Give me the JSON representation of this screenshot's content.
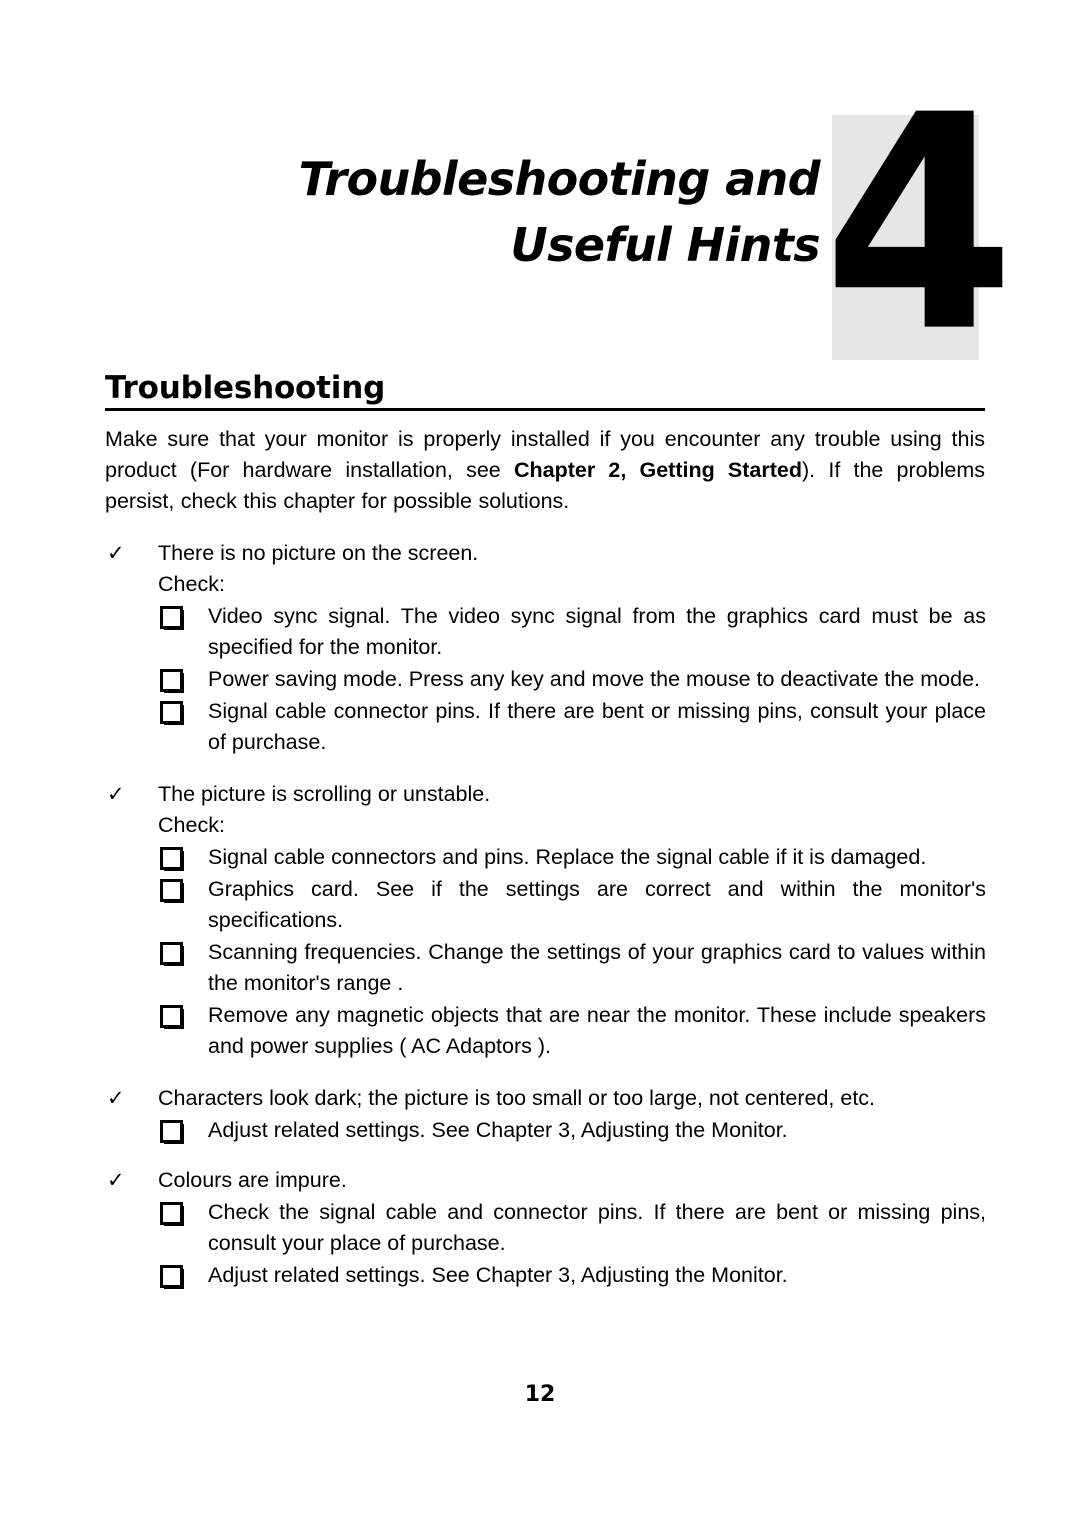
{
  "chapter": {
    "number": "4",
    "title_line1": "Troubleshooting and",
    "title_line2": "Useful Hints",
    "badge_color": "#e6e6e6"
  },
  "section": {
    "heading": "Troubleshooting",
    "intro_part1": "Make sure that your monitor is properly installed if you encounter any trouble using this product (For hardware installation, see ",
    "intro_bold": "Chapter 2, Getting Started",
    "intro_part2": ").  If the problems persist, check this chapter for possible solutions."
  },
  "groups": [
    {
      "tick_icon": "✓",
      "symptom": "There is no picture on the screen.",
      "check_label": "Check:",
      "items": [
        "Video sync signal.  The video sync signal from the graphics card must be as specified for the monitor.",
        "Power saving mode.  Press any key and move the mouse to deactivate the mode.",
        "Signal cable connector pins.  If there are bent or missing pins, consult your place of purchase."
      ]
    },
    {
      "tick_icon": "✓",
      "symptom": "The picture is scrolling or unstable.",
      "check_label": "Check:",
      "items": [
        "Signal cable connectors and pins. Replace the signal cable if it is damaged.",
        "Graphics card.   See if the settings are correct and within the monitor's specifications.",
        "Scanning frequencies.  Change the settings of your graphics card to values within the monitor's range .",
        "Remove any magnetic objects that are near the monitor. These include speakers and power supplies ( AC Adaptors )."
      ]
    },
    {
      "tick_icon": "✓",
      "symptom": "Characters look dark; the picture is too small or too large, not centered, etc.",
      "check_label": "",
      "items": [
        "Adjust related settings.  See Chapter 3, Adjusting the Monitor."
      ]
    },
    {
      "tick_icon": "✓",
      "symptom": "Colours are impure.",
      "check_label": "",
      "items": [
        "Check the signal cable and connector pins.  If there are bent or missing pins, consult your place of purchase.",
        "Adjust related settings.  See Chapter 3, Adjusting the Monitor."
      ]
    }
  ],
  "footer": {
    "page_number": "12"
  }
}
